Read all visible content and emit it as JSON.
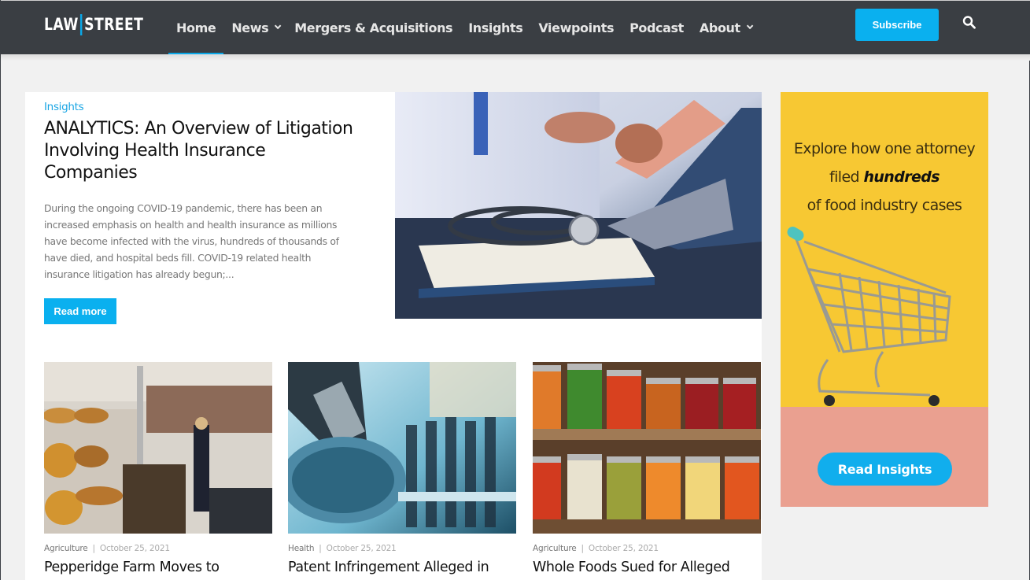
{
  "header": {
    "logo": {
      "left": "LAW",
      "right": "STREET"
    },
    "nav": [
      {
        "label": "Home",
        "active": true,
        "dropdown": false
      },
      {
        "label": "News",
        "active": false,
        "dropdown": true
      },
      {
        "label": "Mergers & Acquisitions",
        "active": false,
        "dropdown": false
      },
      {
        "label": "Insights",
        "active": false,
        "dropdown": false
      },
      {
        "label": "Viewpoints",
        "active": false,
        "dropdown": false
      },
      {
        "label": "Podcast",
        "active": false,
        "dropdown": false
      },
      {
        "label": "About",
        "active": false,
        "dropdown": true
      }
    ],
    "subscribe_label": "Subscribe",
    "search_icon": "search-icon"
  },
  "featured": {
    "category": "Insights",
    "title": "ANALYTICS: An Overview of Litigation Involving Health Insurance Companies",
    "excerpt": "During the ongoing COVID-19 pandemic, there has been an increased emphasis on health and health insurance as millions have become infected with the virus, hundreds of thousands of have died, and hospital beds fill. COVID-19 related health insurance litigation has already begun;...",
    "read_more_label": "Read more",
    "image_alt": "Doctor with stethoscope, notebook and laptop using a calculator"
  },
  "cards": [
    {
      "category": "Agriculture",
      "date": "October 25, 2021",
      "title": "Pepperidge Farm Moves to",
      "image_alt": "Bakery kitchen with racks of bread"
    },
    {
      "category": "Health",
      "date": "October 25, 2021",
      "title": "Patent Infringement Alleged in",
      "image_alt": "Microscope and test tubes in a lab"
    },
    {
      "category": "Agriculture",
      "date": "October 25, 2021",
      "title": "Whole Foods Sued for Alleged",
      "image_alt": "Shelves of canned vegetables in jars"
    }
  ],
  "ad": {
    "line1": "Explore how one attorney",
    "line2_prefix": "filed ",
    "line2_emphasis": "hundreds",
    "line3": "of food industry cases",
    "button_label": "Read Insights",
    "image_alt": "Miniature shopping cart on yellow background"
  },
  "colors": {
    "accent": "#0ab0ef",
    "header_bg": "#3a3e43",
    "page_bg": "#f1f1f1"
  }
}
